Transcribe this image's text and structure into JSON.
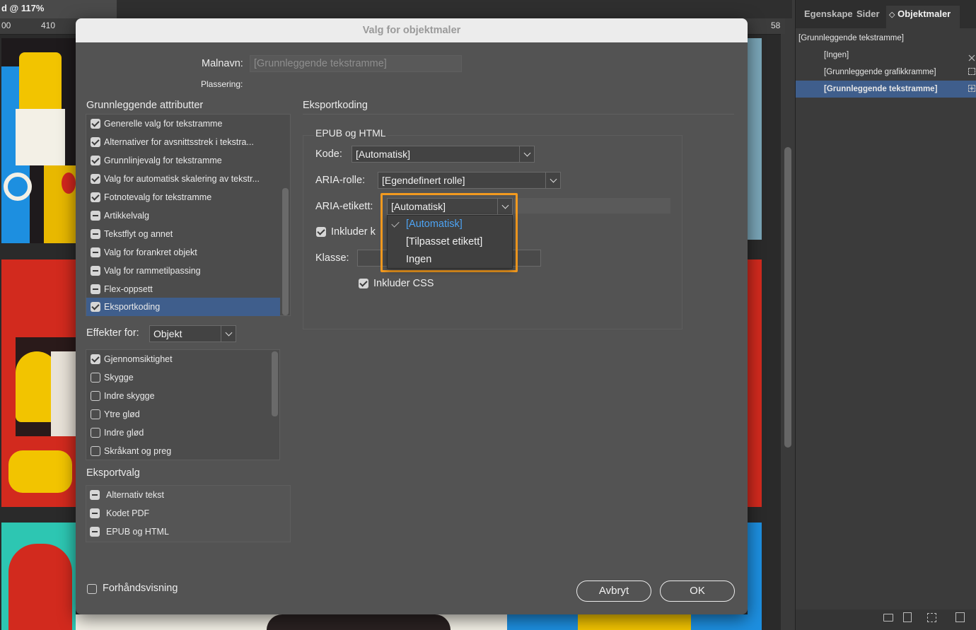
{
  "document": {
    "tab_title": "d @ 117%",
    "ruler": {
      "mark_1": "00",
      "mark_2": "410",
      "mark_3": "58"
    }
  },
  "panel": {
    "tabs": [
      "Egenskape",
      "Sider",
      "Objektmaler"
    ],
    "active_tab_prefix": "◇",
    "current_style": "[Grunnleggende tekstramme]",
    "items": [
      {
        "label": "[Ingen]",
        "icon": "no-style-icon",
        "selected": false
      },
      {
        "label": "[Grunnleggende grafikkramme]",
        "icon": "graphic-frame-icon",
        "selected": false
      },
      {
        "label": "[Grunnleggende tekstramme]",
        "icon": "text-frame-icon",
        "selected": true
      }
    ]
  },
  "dialog": {
    "title": "Valg for objektmaler",
    "style_name_label": "Malnavn:",
    "style_name_value": "[Grunnleggende tekstramme]",
    "location_label": "Plassering:",
    "basic_attributes": {
      "header": "Grunnleggende attributter",
      "items": [
        {
          "label": "Generelle valg for tekstramme",
          "state": "on"
        },
        {
          "label": "Alternativer for avsnittsstrek i tekstra...",
          "state": "on"
        },
        {
          "label": "Grunnlinjevalg for tekstramme",
          "state": "on"
        },
        {
          "label": "Valg for automatisk skalering av tekstr...",
          "state": "on"
        },
        {
          "label": "Fotnotevalg for tekstramme",
          "state": "on"
        },
        {
          "label": "Artikkelvalg",
          "state": "mixed"
        },
        {
          "label": "Tekstflyt og annet",
          "state": "mixed"
        },
        {
          "label": "Valg for forankret objekt",
          "state": "mixed"
        },
        {
          "label": "Valg for rammetilpassing",
          "state": "mixed"
        },
        {
          "label": "Flex-oppsett",
          "state": "mixed"
        },
        {
          "label": "Eksportkoding",
          "state": "on",
          "selected": true
        }
      ]
    },
    "effects_for_label": "Effekter for:",
    "effects_for_value": "Objekt",
    "effects": {
      "items": [
        {
          "label": "Gjennomsiktighet",
          "state": "on"
        },
        {
          "label": "Skygge",
          "state": "off"
        },
        {
          "label": "Indre skygge",
          "state": "off"
        },
        {
          "label": "Ytre glød",
          "state": "off"
        },
        {
          "label": "Indre glød",
          "state": "off"
        },
        {
          "label": "Skråkant og preg",
          "state": "off"
        }
      ]
    },
    "export_options": {
      "header": "Eksportvalg",
      "items": [
        {
          "label": "Alternativ tekst",
          "state": "mixed"
        },
        {
          "label": "Kodet PDF",
          "state": "mixed"
        },
        {
          "label": "EPUB og HTML",
          "state": "mixed"
        }
      ]
    },
    "preview_label": "Forhåndsvisning",
    "preview_checked": false,
    "cancel_label": "Avbryt",
    "ok_label": "OK",
    "export_tagging": {
      "header": "Eksportkoding",
      "group_title": "EPUB og HTML",
      "tag_label": "Kode:",
      "tag_value": "[Automatisk]",
      "aria_role_label": "ARIA-rolle:",
      "aria_role_value": "[Egendefinert rolle]",
      "aria_label_label": "ARIA-etikett:",
      "aria_label_value": "[Automatisk]",
      "include_class_label": "Inkluder k",
      "include_class_checked": true,
      "class_label": "Klasse:",
      "class_value": "",
      "include_css_label": "Inkluder CSS",
      "include_css_checked": true,
      "aria_label_menu": [
        {
          "label": "[Automatisk]",
          "checked": true
        },
        {
          "label": "[Tilpasset etikett]",
          "checked": false
        },
        {
          "label": "Ingen",
          "checked": false
        }
      ]
    }
  },
  "colors": {
    "highlight": "#f39a1f",
    "selection": "#3f5e8c",
    "menu_checked": "#4da3f3"
  }
}
